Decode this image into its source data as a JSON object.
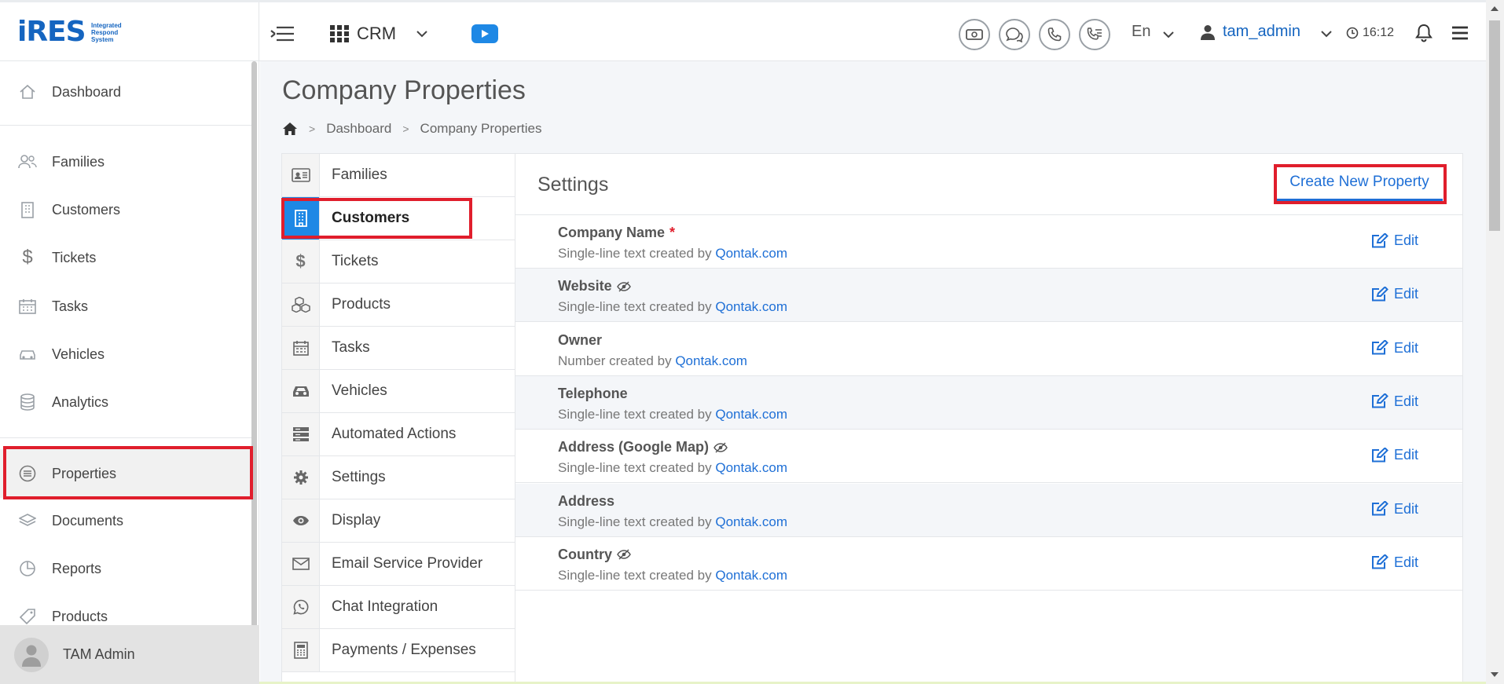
{
  "app": {
    "logo_text": "iRES",
    "logo_subtitle": [
      "Integrated",
      "Respond",
      "System"
    ]
  },
  "topbar": {
    "module": "CRM",
    "language": "En",
    "username": "tam_admin",
    "time": "16:12",
    "icons": [
      "menu-toggle-icon",
      "apps-grid-icon",
      "youtube-icon",
      "money-icon",
      "chat-icon",
      "phone-icon",
      "call-list-icon",
      "user-icon",
      "clock-icon",
      "bell-icon",
      "hamburger-icon"
    ]
  },
  "sidebar": {
    "items": [
      {
        "label": "Dashboard",
        "icon": "home-icon"
      },
      {
        "label": "Families",
        "icon": "users-icon"
      },
      {
        "label": "Customers",
        "icon": "building-icon"
      },
      {
        "label": "Tickets",
        "icon": "dollar-icon"
      },
      {
        "label": "Tasks",
        "icon": "calendar-icon"
      },
      {
        "label": "Vehicles",
        "icon": "car-icon"
      },
      {
        "label": "Analytics",
        "icon": "database-icon"
      },
      {
        "label": "Properties",
        "icon": "list-circle-icon"
      },
      {
        "label": "Documents",
        "icon": "layers-icon"
      },
      {
        "label": "Reports",
        "icon": "pie-chart-icon"
      },
      {
        "label": "Products",
        "icon": "tag-icon"
      }
    ],
    "user_name": "TAM Admin"
  },
  "page": {
    "title": "Company Properties",
    "breadcrumb": [
      "Dashboard",
      "Company Properties"
    ]
  },
  "settings_nav": {
    "items": [
      {
        "label": "Families",
        "icon": "id-card-icon"
      },
      {
        "label": "Customers",
        "icon": "building-icon"
      },
      {
        "label": "Tickets",
        "icon": "dollar-icon"
      },
      {
        "label": "Products",
        "icon": "cubes-icon"
      },
      {
        "label": "Tasks",
        "icon": "calendar-icon"
      },
      {
        "label": "Vehicles",
        "icon": "car-icon"
      },
      {
        "label": "Automated Actions",
        "icon": "server-icon"
      },
      {
        "label": "Settings",
        "icon": "gear-icon"
      },
      {
        "label": "Display",
        "icon": "eye-icon"
      },
      {
        "label": "Email Service Provider",
        "icon": "envelope-icon"
      },
      {
        "label": "Chat Integration",
        "icon": "whatsapp-icon"
      },
      {
        "label": "Payments / Expenses",
        "icon": "calculator-icon"
      }
    ],
    "active": "Customers"
  },
  "panel": {
    "title": "Settings",
    "create_label": "Create New Property",
    "edit_label": "Edit",
    "properties": [
      {
        "name": "Company Name",
        "required": "*",
        "hidden": false,
        "type_text": "Single-line text created by",
        "creator": "Qontak.com"
      },
      {
        "name": "Website",
        "required": "",
        "hidden": true,
        "type_text": "Single-line text created by",
        "creator": "Qontak.com"
      },
      {
        "name": "Owner",
        "required": "",
        "hidden": false,
        "type_text": "Number created by",
        "creator": "Qontak.com"
      },
      {
        "name": "Telephone",
        "required": "",
        "hidden": false,
        "type_text": "Single-line text created by",
        "creator": "Qontak.com"
      },
      {
        "name": "Address (Google Map)",
        "required": "",
        "hidden": true,
        "type_text": "Single-line text created by",
        "creator": "Qontak.com"
      },
      {
        "name": "Address",
        "required": "",
        "hidden": false,
        "type_text": "Single-line text created by",
        "creator": "Qontak.com"
      },
      {
        "name": "Country",
        "required": "",
        "hidden": true,
        "type_text": "Single-line text created by",
        "creator": "Qontak.com"
      }
    ]
  },
  "colors": {
    "accent": "#1e88e5",
    "link": "#1e6fd6",
    "highlight_box": "#e01e2c",
    "required": "#e01e2c"
  }
}
